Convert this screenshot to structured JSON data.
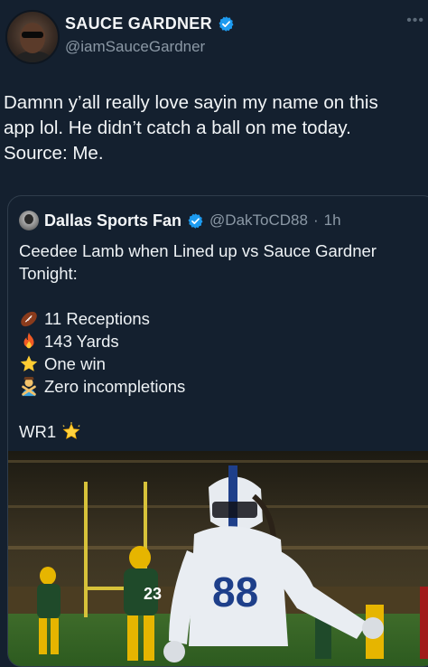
{
  "tweet": {
    "author": {
      "display_name": "SAUCE GARDNER",
      "handle": "@iamSauceGardner",
      "avatar": "author-avatar-photo"
    },
    "more_icon": "more-options-icon",
    "text_lines": [
      "Damnn y’all really love sayin my name  on this",
      "app lol. He didn’t catch a ball on me today.",
      "Source: Me."
    ]
  },
  "quote": {
    "author": {
      "display_name": "Dallas Sports Fan",
      "handle": "@DakToCD88",
      "separator": "·",
      "time": "1h"
    },
    "intro_lines": [
      "Ceedee Lamb when Lined up vs Sauce Gardner",
      "Tonight:"
    ],
    "stats": [
      {
        "icon": "football-emoji",
        "text": "11 Receptions"
      },
      {
        "icon": "fire-emoji",
        "text": "143 Yards"
      },
      {
        "icon": "star-emoji",
        "text": "One win"
      },
      {
        "icon": "person-gesturing-no-emoji",
        "text": "Zero incompletions"
      }
    ],
    "closing": "WR1",
    "closing_icon": "glowing-star-emoji",
    "media": {
      "jersey_number": "88"
    }
  },
  "colors": {
    "background": "#14202f",
    "verified_blue": "#1d9bf0",
    "secondary_text": "#8b98a5",
    "border": "#2f3d4c"
  }
}
